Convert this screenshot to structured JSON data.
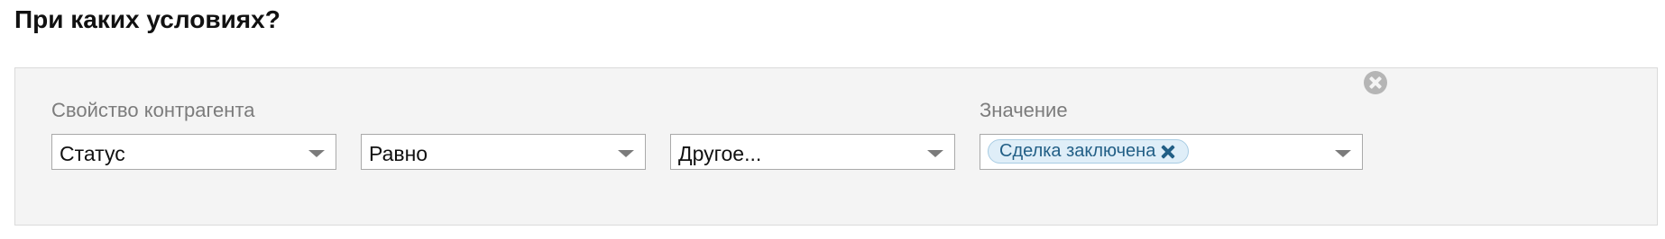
{
  "heading": "При каких условиях?",
  "condition": {
    "property_label": "Свойство контрагента",
    "property_value": "Статус",
    "operator_value": "Равно",
    "source_value": "Другое...",
    "value_label": "Значение",
    "value_tags": [
      "Сделка заключена"
    ]
  },
  "icons": {
    "remove_condition": "close-circle-icon",
    "tag_remove": "close-icon",
    "dropdown": "chevron-down-icon"
  },
  "colors": {
    "tag_background": "#dfeef8",
    "tag_text": "#225f86",
    "panel_background": "#f4f4f4"
  }
}
